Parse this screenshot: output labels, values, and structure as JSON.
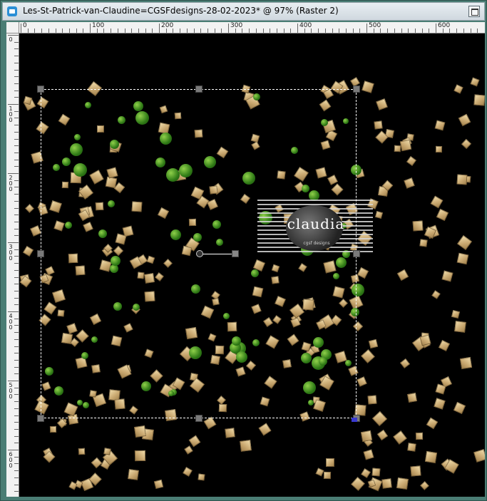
{
  "window": {
    "title": "Les-St-Patrick-van-Claudine=CGSFdesigns-28-02-2023* @  97% (Raster 2)"
  },
  "rulers": {
    "horizontal_labels": [
      "0",
      "100",
      "200",
      "300",
      "400",
      "500",
      "600"
    ],
    "vertical_labels": [
      "0",
      "100",
      "200",
      "300",
      "400",
      "500",
      "600"
    ]
  },
  "icons": {
    "app": "document-icon",
    "maximize": "maximize-icon",
    "pivot": "pivot-icon",
    "rotate": "rotate-handle-icon"
  },
  "watermark": {
    "text": "claudia",
    "subtext": "cgsf designs"
  },
  "colors": {
    "canvas_background": "#000000",
    "confetti_gold": "#d9bd82",
    "clover_green": "#4fa61f",
    "selection_border": "#ffffff",
    "window_frame": "#4a7d74"
  }
}
